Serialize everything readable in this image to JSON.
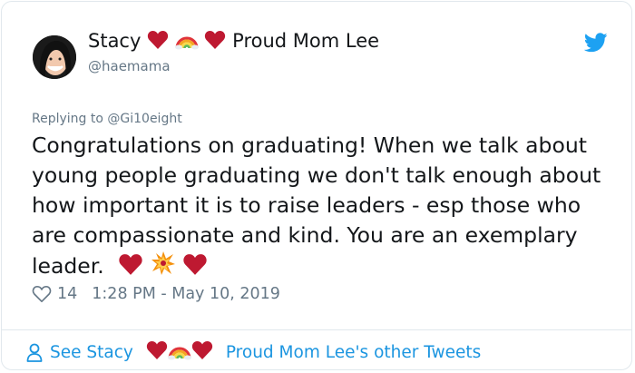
{
  "author": {
    "name_prefix": "Stacy",
    "name_suffix": "Proud Mom Lee",
    "handle": "@haemama"
  },
  "reply": {
    "prefix": "Replying to",
    "handle": "@Gi10eight"
  },
  "tweet": {
    "text_main": "Congratulations on graduating! When we talk about young people graduating we don't talk enough about how important it is to raise leaders - esp those who are compassionate and kind. You are an exemplary leader.",
    "likes": "14",
    "timestamp": "1:28 PM - May 10, 2019"
  },
  "footer": {
    "see_prefix": "See Stacy",
    "see_suffix": "Proud Mom Lee's other Tweets"
  },
  "colors": {
    "twitter_blue": "#1da1f2",
    "link_blue": "#1b95e0",
    "heart_red": "#be1931",
    "muted_gray": "#657786"
  },
  "icons": [
    "twitter-bird-icon",
    "heart-outline-icon",
    "person-icon",
    "red-heart-emoji",
    "rainbow-emoji",
    "collision-emoji"
  ]
}
